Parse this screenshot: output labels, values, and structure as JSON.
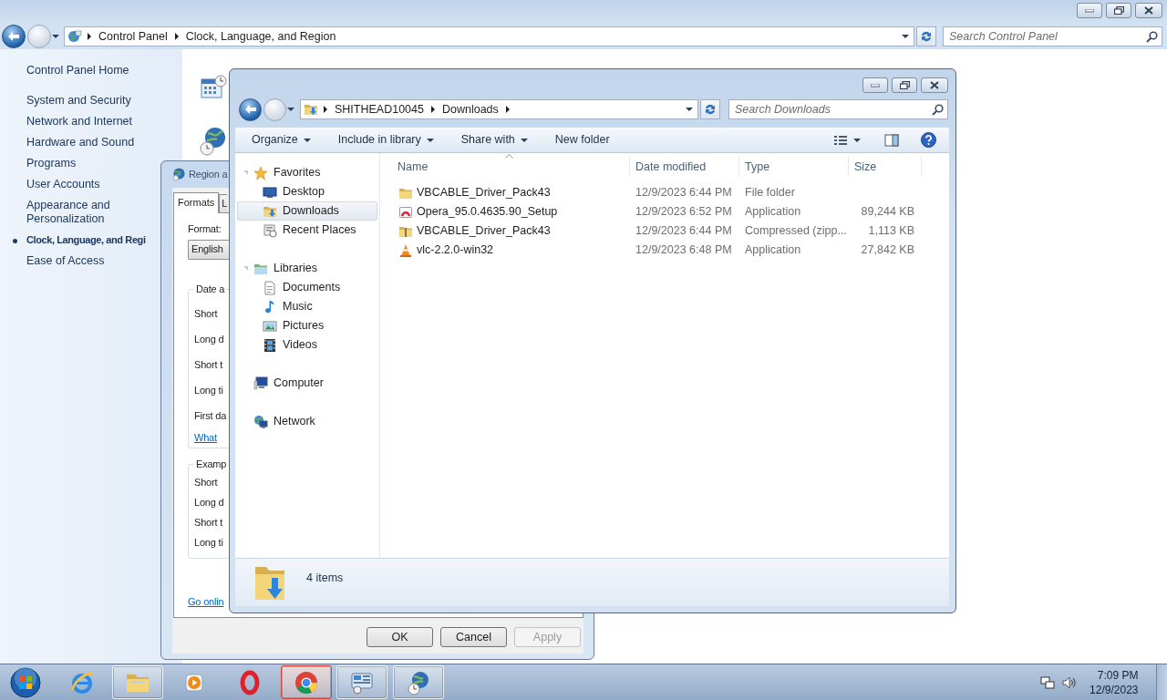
{
  "control_panel": {
    "breadcrumb": [
      "Control Panel",
      "Clock, Language, and Region"
    ],
    "search": {
      "placeholder": "Search Control Panel"
    },
    "home_link": "Control Panel Home",
    "categories": [
      {
        "label": "System and Security",
        "selected": false
      },
      {
        "label": "Network and Internet",
        "selected": false
      },
      {
        "label": "Hardware and Sound",
        "selected": false
      },
      {
        "label": "Programs",
        "selected": false
      },
      {
        "label": "User Accounts",
        "selected": false
      },
      {
        "label": "Appearance and Personalization",
        "selected": false
      },
      {
        "label": "Clock, Language, and Regi",
        "selected": true
      },
      {
        "label": "Ease of Access",
        "selected": false
      }
    ]
  },
  "region_dialog": {
    "title": "Region a",
    "tabs": [
      {
        "label": "Formats",
        "selected": true
      },
      {
        "label": "L",
        "selected": false
      }
    ],
    "format_label": "Format:",
    "format_value": "English",
    "date_group": {
      "legend": "Date a",
      "rows": [
        "Short",
        "Long d",
        "Short t",
        "Long ti",
        "First da"
      ],
      "link": "What"
    },
    "examples_group": {
      "legend": "Examp",
      "rows": [
        "Short",
        "Long d",
        "Short t",
        "Long ti"
      ]
    },
    "online_link": "Go onlin",
    "buttons": [
      {
        "label": "OK",
        "disabled": false
      },
      {
        "label": "Cancel",
        "disabled": false
      },
      {
        "label": "Apply",
        "disabled": true
      }
    ]
  },
  "explorer": {
    "breadcrumb": [
      "SHITHEAD10045",
      "Downloads"
    ],
    "search": {
      "placeholder": "Search Downloads"
    },
    "toolbar": [
      {
        "label": "Organize",
        "dropdown": true
      },
      {
        "label": "Include in library",
        "dropdown": true
      },
      {
        "label": "Share with",
        "dropdown": true
      },
      {
        "label": "New folder",
        "dropdown": false
      }
    ],
    "nav": [
      {
        "label": "Favorites",
        "kind": "star",
        "expanded": true,
        "selected": false,
        "children": [
          {
            "label": "Desktop",
            "kind": "desktop",
            "selected": false
          },
          {
            "label": "Downloads",
            "kind": "downloads",
            "selected": true
          },
          {
            "label": "Recent Places",
            "kind": "recent",
            "selected": false
          }
        ]
      },
      {
        "label": "Libraries",
        "kind": "libraries",
        "expanded": true,
        "selected": false,
        "children": [
          {
            "label": "Documents",
            "kind": "document",
            "selected": false
          },
          {
            "label": "Music",
            "kind": "music",
            "selected": false
          },
          {
            "label": "Pictures",
            "kind": "pictures",
            "selected": false
          },
          {
            "label": "Videos",
            "kind": "videos",
            "selected": false
          }
        ]
      },
      {
        "label": "Computer",
        "kind": "computer",
        "expanded": false,
        "selected": false
      },
      {
        "label": "Network",
        "kind": "network",
        "expanded": false,
        "selected": false
      }
    ],
    "columns": [
      {
        "label": "Name",
        "sorted": true
      },
      {
        "label": "Date modified",
        "sorted": false
      },
      {
        "label": "Type",
        "sorted": false
      },
      {
        "label": "Size",
        "sorted": false
      }
    ],
    "files": [
      {
        "name": "VBCABLE_Driver_Pack43",
        "kind": "folder",
        "date": "12/9/2023 6:44 PM",
        "type": "File folder"
      },
      {
        "name": "Opera_95.0.4635.90_Setup",
        "kind": "installer",
        "date": "12/9/2023 6:52 PM",
        "type": "Application",
        "size": "89,244 KB"
      },
      {
        "name": "VBCABLE_Driver_Pack43",
        "kind": "archive",
        "date": "12/9/2023 6:44 PM",
        "type": "Compressed (zipp...",
        "size": "1,113 KB"
      },
      {
        "name": "vlc-2.2.0-win32",
        "kind": "cone",
        "date": "12/9/2023 6:48 PM",
        "type": "Application",
        "size": "27,842 KB"
      }
    ],
    "status": "4 items"
  },
  "taskbar": {
    "apps": [
      {
        "kind": "browser-e",
        "running": false,
        "flashing": false
      },
      {
        "kind": "folder",
        "running": true,
        "flashing": false
      },
      {
        "kind": "media",
        "running": false,
        "flashing": false
      },
      {
        "kind": "ring",
        "running": false,
        "flashing": false
      },
      {
        "kind": "browser-round",
        "running": true,
        "flashing": true
      },
      {
        "kind": "panel",
        "running": true,
        "flashing": false
      },
      {
        "kind": "globe",
        "running": true,
        "flashing": false
      }
    ],
    "clock": {
      "time": "7:09 PM",
      "date": "12/9/2023"
    }
  }
}
